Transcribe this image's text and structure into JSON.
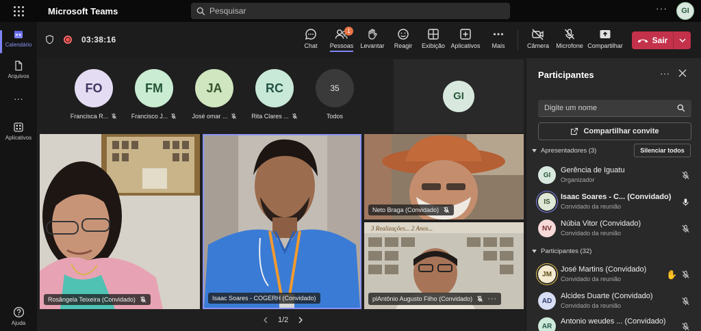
{
  "app": {
    "title": "Microsoft Teams"
  },
  "search": {
    "placeholder": "Pesquisar"
  },
  "user": {
    "initials": "GI"
  },
  "rail": {
    "items": [
      {
        "label": "Calendário",
        "icon": "calendar-icon"
      },
      {
        "label": "Arquivos",
        "icon": "file-icon"
      },
      {
        "label": "Aplicativos",
        "icon": "apps-icon"
      },
      {
        "label": "Ajuda",
        "icon": "help-icon"
      }
    ]
  },
  "meeting": {
    "timer": "03:38:16",
    "people_badge": "1",
    "toolbar": [
      {
        "label": "Chat",
        "icon": "chat-icon"
      },
      {
        "label": "Pessoas",
        "icon": "people-icon"
      },
      {
        "label": "Levantar",
        "icon": "raise-hand-icon"
      },
      {
        "label": "Reagir",
        "icon": "react-icon"
      },
      {
        "label": "Exibição",
        "icon": "view-icon"
      },
      {
        "label": "Aplicativos",
        "icon": "apps-add-icon"
      },
      {
        "label": "Mais",
        "icon": "more-icon"
      },
      {
        "label": "Câmera",
        "icon": "camera-off-icon"
      },
      {
        "label": "Microfone",
        "icon": "mic-off-icon"
      },
      {
        "label": "Compartilhar",
        "icon": "share-icon"
      }
    ],
    "leave_label": "Sair"
  },
  "gallery": [
    {
      "initials": "FO",
      "name": "Francisca R...",
      "bg": "#e4dcf2",
      "fg": "#3e3560"
    },
    {
      "initials": "FM",
      "name": "Francisco J...",
      "bg": "#c9ecd2",
      "fg": "#245533"
    },
    {
      "initials": "JA",
      "name": "José omar ...",
      "bg": "#cfe6c0",
      "fg": "#35522a"
    },
    {
      "initials": "RC",
      "name": "Rita Clares ...",
      "bg": "#c8e8d8",
      "fg": "#245545"
    },
    {
      "initials": "35",
      "name": "Todos",
      "bg": "#3a3a3a",
      "fg": "#e6e6e6"
    }
  ],
  "self_tile": {
    "initials": "GI"
  },
  "videos": [
    {
      "label": "Rosângela Teixeira (Convidado)"
    },
    {
      "label": "Isaac Soares - COGERH (Convidado)"
    },
    {
      "label": "Neto Braga (Convidado)"
    },
    {
      "label": "plAntônio Augusto Filho (Convidado)"
    }
  ],
  "pager": {
    "text": "1/2"
  },
  "panel": {
    "title": "Participantes",
    "search_placeholder": "Digite um nome",
    "share_label": "Compartilhar convite",
    "presenters_header": "Apresentadores (3)",
    "mute_all_label": "Silenciar todos",
    "participants_header": "Participantes (32)",
    "presenters": [
      {
        "initials": "GI",
        "name": "Gerência de Iguatu",
        "guest": "",
        "role": "Organizador",
        "bg": "#d8e8de",
        "fg": "#2a5a3a",
        "mic": "off"
      },
      {
        "initials": "IS",
        "name": "Isaac Soares - C...",
        "guest": "(Convidado)",
        "role": "Convidado da reunião",
        "bg": "#dfe7d6",
        "fg": "#3d5230",
        "mic": "on"
      },
      {
        "initials": "NV",
        "name": "Núbia Vitor (Convidado)",
        "guest": "",
        "role": "Convidado da reunião",
        "bg": "#f6d9d9",
        "fg": "#7a2c2c",
        "mic": "off"
      }
    ],
    "participants": [
      {
        "initials": "JM",
        "name": "José Martins (Convidado)",
        "role": "Convidado da reunião",
        "bg": "#f3ead0",
        "fg": "#5a4a16",
        "mic": "off",
        "hand": "✋"
      },
      {
        "initials": "AD",
        "name": "Alcides Duarte (Convidado)",
        "role": "Convidado da reunião",
        "bg": "#d8def4",
        "fg": "#2e3a6a",
        "mic": "off"
      },
      {
        "initials": "AR",
        "name": "Antonio weudes ... (Convidado)",
        "role": "",
        "bg": "#cde9d9",
        "fg": "#245545",
        "mic": "off"
      }
    ]
  }
}
